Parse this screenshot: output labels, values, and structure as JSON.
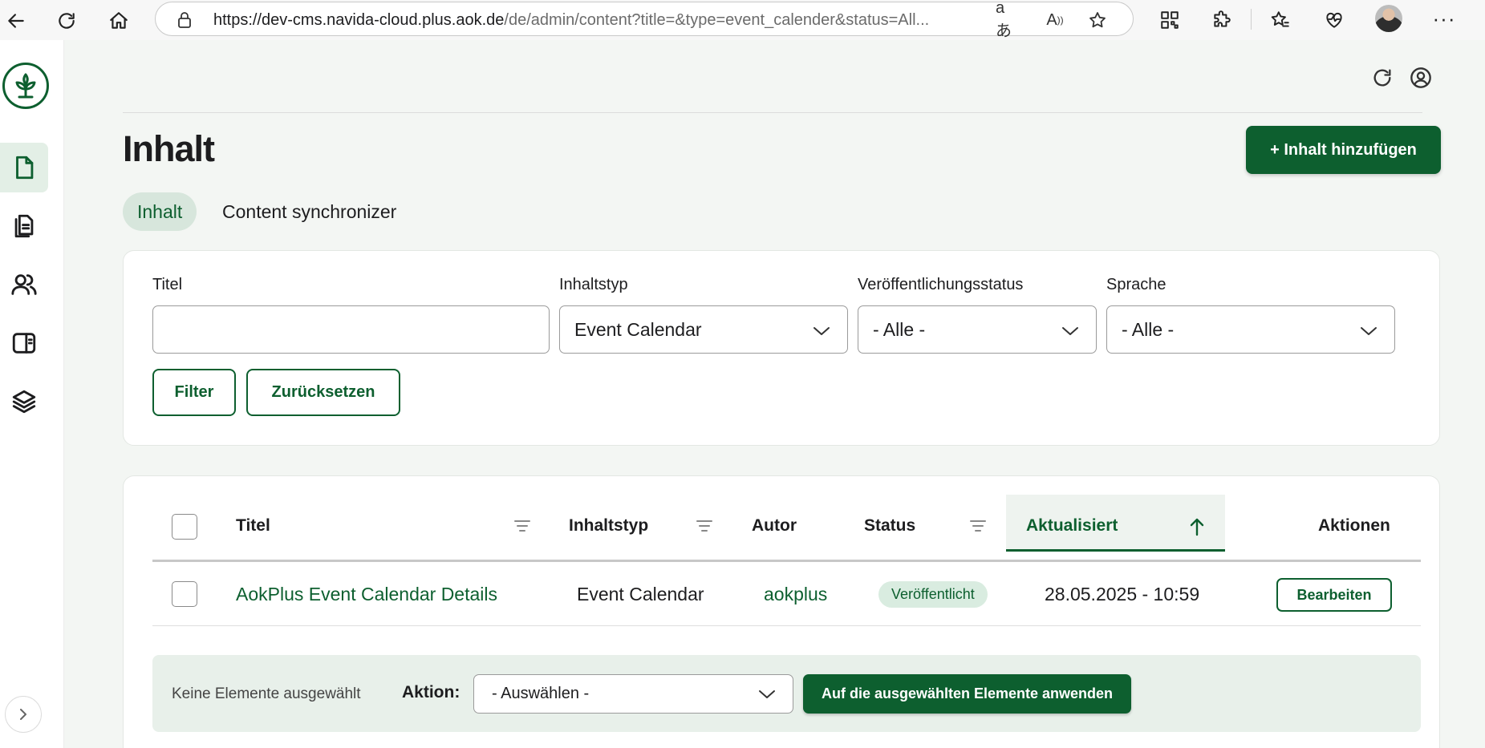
{
  "browser": {
    "url_host": "https://dev-cms.navida-cloud.plus.aok.de",
    "url_path": "/de/admin/content?title=&type=event_calender&status=All..."
  },
  "icons": {
    "back": "arrow-left-icon",
    "reload": "refresh-icon",
    "home": "home-icon",
    "lock": "lock-icon",
    "translate": "translate-icon",
    "read_aloud": "read-aloud-icon",
    "favorite": "star-icon",
    "qr": "qr-code-icon",
    "extensions": "puzzle-icon",
    "favorites": "favorites-icon",
    "health": "heart-pulse-icon",
    "more": "more-dots-icon"
  },
  "theme": {
    "primary": "#0d5f2f",
    "primary_light": "#d7e6dc",
    "background": "#f3f6f3"
  },
  "page": {
    "title": "Inhalt",
    "add_button": "+ Inhalt hinzufügen",
    "tabs": [
      {
        "label": "Inhalt",
        "active": true
      },
      {
        "label": "Content synchronizer",
        "active": false
      }
    ]
  },
  "filters": {
    "title_label": "Titel",
    "title_value": "",
    "type_label": "Inhaltstyp",
    "type_value": "Event Calendar",
    "status_label": "Veröffentlichungsstatus",
    "status_value": "- Alle -",
    "language_label": "Sprache",
    "language_value": "- Alle -",
    "filter_button": "Filter",
    "reset_button": "Zurücksetzen"
  },
  "table": {
    "columns": {
      "title": "Titel",
      "type": "Inhaltstyp",
      "author": "Autor",
      "status": "Status",
      "updated": "Aktualisiert",
      "actions": "Aktionen"
    },
    "rows": [
      {
        "title": "AokPlus Event Calendar Details",
        "type": "Event Calendar",
        "author": "aokplus",
        "status": "Veröffentlicht",
        "updated": "28.05.2025 - 10:59",
        "action": "Bearbeiten"
      }
    ]
  },
  "bulk": {
    "none_selected": "Keine Elemente ausgewählt",
    "action_label": "Aktion:",
    "select_value": "- Auswählen -",
    "apply_button": "Auf die ausgewählten Elemente anwenden"
  }
}
